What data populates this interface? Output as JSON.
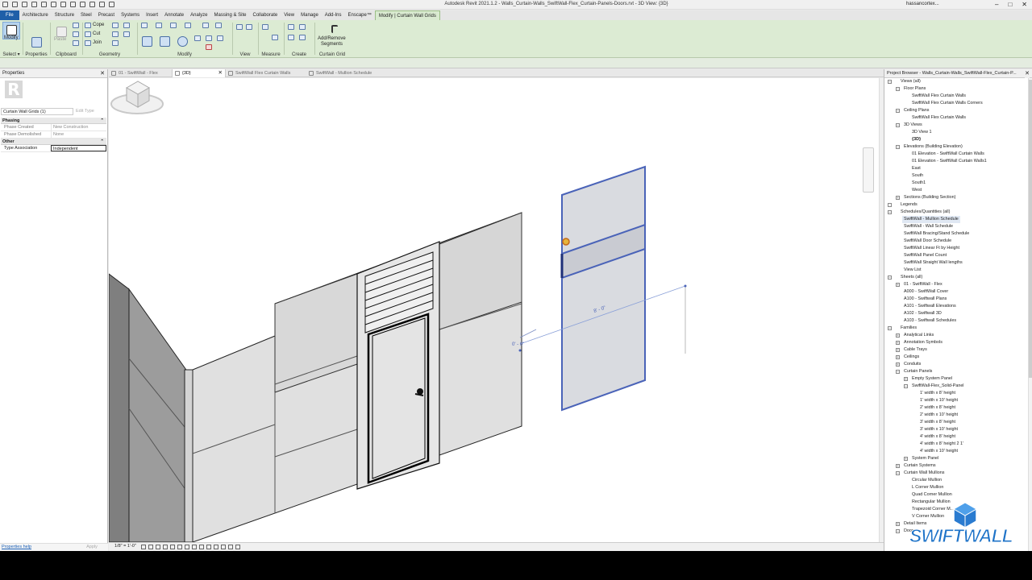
{
  "window": {
    "title": "Autodesk Revit 2021.1.2 - Walls_Curtain-Walls_SwiftWall-Flex_Curtain-Panels-Doors.rvt - 3D View: {3D}",
    "user": "hassancortex..."
  },
  "tabs": [
    "File",
    "Architecture",
    "Structure",
    "Steel",
    "Precast",
    "Systems",
    "Insert",
    "Annotate",
    "Analyze",
    "Massing & Site",
    "Collaborate",
    "View",
    "Manage",
    "Add-Ins",
    "Enscape™",
    "Modify | Curtain Wall Grids"
  ],
  "ribbon": {
    "modify_label": "Modify",
    "cope": "Cope",
    "cut": "Cut",
    "join": "Join",
    "paste": "Paste",
    "add_remove": "Add/Remove",
    "segments": "Segments",
    "groups": [
      "Select ▾",
      "Properties",
      "Clipboard",
      "Geometry",
      "Modify",
      "View",
      "Measure",
      "Create",
      "Curtain Grid"
    ]
  },
  "properties": {
    "title": "Properties",
    "type_name": "Curtain Wall Grids (1)",
    "edit_type": "Edit Type",
    "sections": [
      {
        "name": "Phasing",
        "rows": [
          {
            "k": "Phase Created",
            "v": "New Construction"
          },
          {
            "k": "Phase Demolished",
            "v": "None"
          }
        ]
      },
      {
        "name": "Other",
        "rows": [
          {
            "k": "Type Association",
            "v": "Independent"
          }
        ]
      }
    ],
    "help": "Properties help",
    "apply": "Apply"
  },
  "view_tabs": [
    {
      "label": "01 - SwiftWall - Flex",
      "active": false
    },
    {
      "label": "{3D}",
      "active": true
    },
    {
      "label": "SwiftWall Flex Curtain Walls",
      "active": false
    },
    {
      "label": "SwiftWall - Mullion Schedule",
      "active": false
    }
  ],
  "canvas": {
    "dim_left": "0' - 0\"",
    "dim_right": "8' - 0\"",
    "scale": "1/8\" = 1'-0\""
  },
  "browser": {
    "title": "Project Browser - Walls_Curtain-Walls_SwiftWall-Flex_Curtain-P...",
    "items": [
      {
        "label": "Views (all)",
        "level": 0,
        "toggle": "-"
      },
      {
        "label": "Floor Plans",
        "level": 1,
        "toggle": "-"
      },
      {
        "label": "SwiftWall Flex Curtain Walls",
        "level": 2
      },
      {
        "label": "SwiftWall Flex Curtain Walls Corners",
        "level": 2
      },
      {
        "label": "Ceiling Plans",
        "level": 1,
        "toggle": "-"
      },
      {
        "label": "SwiftWall Flex Curtain Walls",
        "level": 2
      },
      {
        "label": "3D Views",
        "level": 1,
        "toggle": "-"
      },
      {
        "label": "3D View 1",
        "level": 2
      },
      {
        "label": "{3D}",
        "level": 2,
        "bold": true
      },
      {
        "label": "Elevations (Building Elevation)",
        "level": 1,
        "toggle": "-"
      },
      {
        "label": "01 Elevation - SwiftWall Curtain Walls",
        "level": 2
      },
      {
        "label": "01 Elevation - SwiftWall Curtain Walls1",
        "level": 2
      },
      {
        "label": "East",
        "level": 2
      },
      {
        "label": "South",
        "level": 2
      },
      {
        "label": "South1",
        "level": 2
      },
      {
        "label": "West",
        "level": 2
      },
      {
        "label": "Sections (Building Section)",
        "level": 1,
        "toggle": "+"
      },
      {
        "label": "Legends",
        "level": 0,
        "toggle": "icon"
      },
      {
        "label": "Schedules/Quantities (all)",
        "level": 0,
        "toggle": "-"
      },
      {
        "label": "SwiftWall - Mullion Schedule",
        "level": 1,
        "selected": true
      },
      {
        "label": "SwiftWall - Wall Schedule",
        "level": 1
      },
      {
        "label": "SwiftWall Bracing/Stand Schedule",
        "level": 1
      },
      {
        "label": "SwiftWall Door Schedule",
        "level": 1
      },
      {
        "label": "SwiftWall Linear Ft by Height",
        "level": 1
      },
      {
        "label": "SwiftWall Panel Count",
        "level": 1
      },
      {
        "label": "SwiftWall Straight Wall lengths",
        "level": 1
      },
      {
        "label": "View List",
        "level": 1
      },
      {
        "label": "Sheets (all)",
        "level": 0,
        "toggle": "-"
      },
      {
        "label": "01 - SwiftWall - Flex",
        "level": 1,
        "toggle": "+"
      },
      {
        "label": "A000 - SwiftWall Cover",
        "level": 1
      },
      {
        "label": "A100 - Swiftwall Plans",
        "level": 1
      },
      {
        "label": "A101 - Swiftwall Elevations",
        "level": 1
      },
      {
        "label": "A102 - Swiftwall 3D",
        "level": 1
      },
      {
        "label": "A103 - Swiftwall Schedules",
        "level": 1
      },
      {
        "label": "Families",
        "level": 0,
        "toggle": "-"
      },
      {
        "label": "Analytical Links",
        "level": 1,
        "toggle": "+"
      },
      {
        "label": "Annotation Symbols",
        "level": 1,
        "toggle": "+"
      },
      {
        "label": "Cable Trays",
        "level": 1,
        "toggle": "+"
      },
      {
        "label": "Ceilings",
        "level": 1,
        "toggle": "+"
      },
      {
        "label": "Conduits",
        "level": 1,
        "toggle": "+"
      },
      {
        "label": "Curtain Panels",
        "level": 1,
        "toggle": "-"
      },
      {
        "label": "Empty System Panel",
        "level": 2,
        "toggle": "+"
      },
      {
        "label": "SwiftWall-Flex_Solid-Panel",
        "level": 2,
        "toggle": "-"
      },
      {
        "label": "1' width x 8' height",
        "level": 3
      },
      {
        "label": "1' width x 10' height",
        "level": 3
      },
      {
        "label": "2' width x 8' height",
        "level": 3
      },
      {
        "label": "2' width x 10' height",
        "level": 3
      },
      {
        "label": "3' width x 8' height",
        "level": 3
      },
      {
        "label": "3' width x 10' height",
        "level": 3
      },
      {
        "label": "4' width x 8' height",
        "level": 3
      },
      {
        "label": "4' width x 8' height 2 1'",
        "level": 3
      },
      {
        "label": "4' width x 10' height",
        "level": 3
      },
      {
        "label": "System Panel",
        "level": 2,
        "toggle": "+"
      },
      {
        "label": "Curtain Systems",
        "level": 1,
        "toggle": "+"
      },
      {
        "label": "Curtain Wall Mullions",
        "level": 1,
        "toggle": "-"
      },
      {
        "label": "Circular Mullion",
        "level": 2
      },
      {
        "label": "L Corner Mullion",
        "level": 2
      },
      {
        "label": "Quad Corner Mullion",
        "level": 2
      },
      {
        "label": "Rectangular Mullion",
        "level": 2
      },
      {
        "label": "Trapezoid Corner M...",
        "level": 2
      },
      {
        "label": "V Corner Mullion",
        "level": 2
      },
      {
        "label": "Detail Items",
        "level": 1,
        "toggle": "+"
      },
      {
        "label": "Doors",
        "level": 1,
        "toggle": "-"
      }
    ]
  },
  "watermark": "SWIFTWALL",
  "colors": {
    "ribbon": "#dcebd3",
    "file_tab": "#1f5fa8",
    "selection": "#4a63b8",
    "watermark": "#1e73c8"
  }
}
